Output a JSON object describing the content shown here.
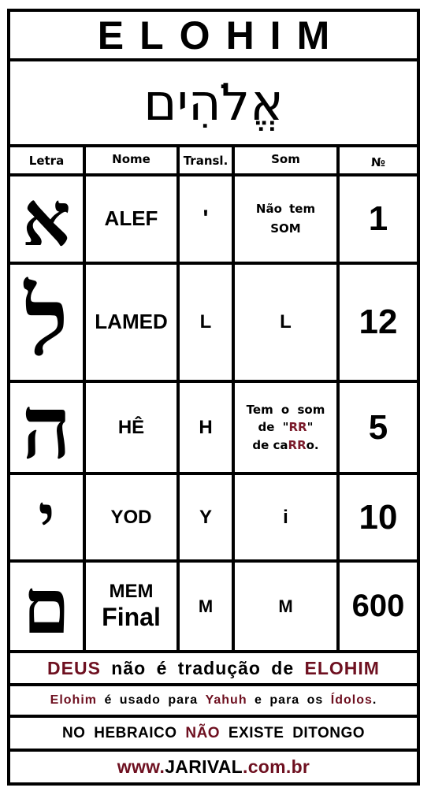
{
  "title": "ELOHIM",
  "hebrew_word": "אֱלֹהִים",
  "headers": [
    "Letra",
    "Nome",
    "Transl.",
    "Som",
    "№"
  ],
  "rows": [
    {
      "letter": "א",
      "name": [
        "ALEF"
      ],
      "translit": "'",
      "sound": [
        "Não tem",
        "SOM"
      ],
      "number": "1"
    },
    {
      "letter": "ל",
      "name": [
        "LAMED"
      ],
      "translit": "L",
      "sound": [
        "L"
      ],
      "number": "12"
    },
    {
      "letter": "ה",
      "name": [
        "HÊ"
      ],
      "translit": "H",
      "sound_parts": {
        "line1": "Tem o som",
        "line2_a": "de \"",
        "line2_b": "RR",
        "line2_c": "\"",
        "line3_a": "de ca",
        "line3_b": "RR",
        "line3_c": "o."
      },
      "number": "5"
    },
    {
      "letter": "י",
      "name": [
        "YOD"
      ],
      "translit": "Y",
      "sound": [
        "i"
      ],
      "number": "10"
    },
    {
      "letter": "ם",
      "name": [
        "MEM",
        "Final"
      ],
      "translit": "M",
      "sound": [
        "M"
      ],
      "number": "600"
    }
  ],
  "notes": {
    "line1": {
      "a": "DEUS",
      "b": " não é tradução de ",
      "c": "ELOHIM"
    },
    "line2": {
      "a": "Elohim",
      "b": " é usado para ",
      "c": "Yahuh",
      "d": " e para os ",
      "e": "Ídolos",
      "f": "."
    },
    "line3": {
      "a": "NO HEBRAICO ",
      "b": "NÃO",
      "c": " EXISTE DITONGO"
    },
    "website": {
      "a": "www.",
      "b": "JARIVAL",
      "c": ".com.br"
    }
  },
  "colors": {
    "accent": "#6e1020",
    "border": "#000000",
    "background": "#ffffff"
  }
}
